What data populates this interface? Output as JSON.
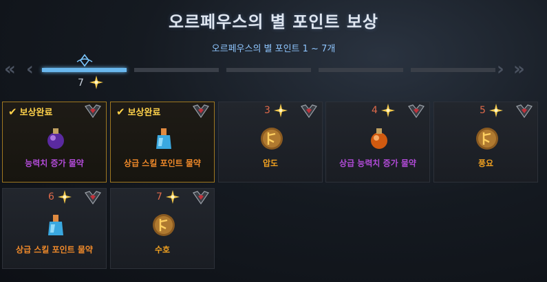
{
  "header": {
    "title": "오르페우스의 별 포인트 보상",
    "subtitle": "오르페우스의 별 포인트 1 ~ 7개"
  },
  "progress": {
    "current_points": "7",
    "active_segment": 1,
    "total_segments": 5
  },
  "nav": {
    "first": "«",
    "prev": "‹",
    "next": "›",
    "last": "»"
  },
  "rewards": [
    {
      "status_label": "보상완료",
      "name": "능력치 증가 물약",
      "name_color": "purple",
      "icon": "purple-potion-icon",
      "completed": true
    },
    {
      "status_label": "보상완료",
      "name": "상급 스킬 포인트 물약",
      "name_color": "orange",
      "icon": "blue-potion-icon",
      "completed": true
    },
    {
      "points": "3",
      "name": "압도",
      "name_color": "amber",
      "icon": "rune-icon",
      "completed": false
    },
    {
      "points": "4",
      "name": "상급 능력치 증가 물약",
      "name_color": "purple",
      "icon": "orange-potion-icon",
      "completed": false
    },
    {
      "points": "5",
      "name": "풍요",
      "name_color": "amber",
      "icon": "rune-icon",
      "completed": false
    },
    {
      "points": "6",
      "name": "상급 스킬 포인트 물약",
      "name_color": "orange",
      "icon": "blue-potion-icon",
      "completed": false
    },
    {
      "points": "7",
      "name": "수호",
      "name_color": "amber",
      "icon": "rune-icon",
      "completed": false
    }
  ],
  "colors": {
    "accent": "#6ab8ee",
    "completed": "#ffd24a",
    "points": "#e06a4a"
  }
}
